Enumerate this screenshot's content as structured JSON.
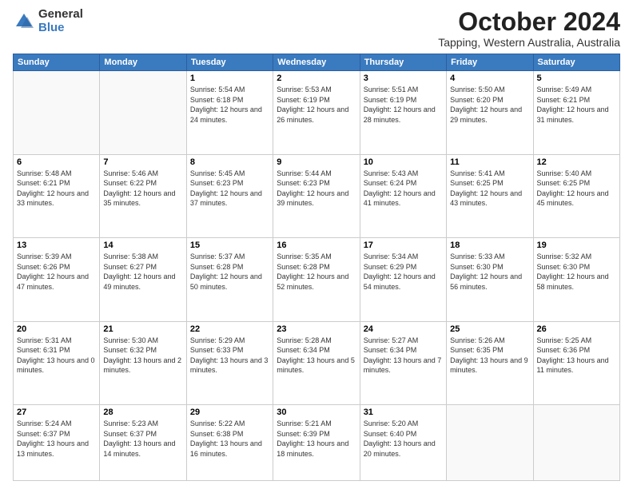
{
  "logo": {
    "general": "General",
    "blue": "Blue"
  },
  "header": {
    "month": "October 2024",
    "location": "Tapping, Western Australia, Australia"
  },
  "weekdays": [
    "Sunday",
    "Monday",
    "Tuesday",
    "Wednesday",
    "Thursday",
    "Friday",
    "Saturday"
  ],
  "weeks": [
    [
      {
        "day": "",
        "info": ""
      },
      {
        "day": "",
        "info": ""
      },
      {
        "day": "1",
        "info": "Sunrise: 5:54 AM\nSunset: 6:18 PM\nDaylight: 12 hours and 24 minutes."
      },
      {
        "day": "2",
        "info": "Sunrise: 5:53 AM\nSunset: 6:19 PM\nDaylight: 12 hours and 26 minutes."
      },
      {
        "day": "3",
        "info": "Sunrise: 5:51 AM\nSunset: 6:19 PM\nDaylight: 12 hours and 28 minutes."
      },
      {
        "day": "4",
        "info": "Sunrise: 5:50 AM\nSunset: 6:20 PM\nDaylight: 12 hours and 29 minutes."
      },
      {
        "day": "5",
        "info": "Sunrise: 5:49 AM\nSunset: 6:21 PM\nDaylight: 12 hours and 31 minutes."
      }
    ],
    [
      {
        "day": "6",
        "info": "Sunrise: 5:48 AM\nSunset: 6:21 PM\nDaylight: 12 hours and 33 minutes."
      },
      {
        "day": "7",
        "info": "Sunrise: 5:46 AM\nSunset: 6:22 PM\nDaylight: 12 hours and 35 minutes."
      },
      {
        "day": "8",
        "info": "Sunrise: 5:45 AM\nSunset: 6:23 PM\nDaylight: 12 hours and 37 minutes."
      },
      {
        "day": "9",
        "info": "Sunrise: 5:44 AM\nSunset: 6:23 PM\nDaylight: 12 hours and 39 minutes."
      },
      {
        "day": "10",
        "info": "Sunrise: 5:43 AM\nSunset: 6:24 PM\nDaylight: 12 hours and 41 minutes."
      },
      {
        "day": "11",
        "info": "Sunrise: 5:41 AM\nSunset: 6:25 PM\nDaylight: 12 hours and 43 minutes."
      },
      {
        "day": "12",
        "info": "Sunrise: 5:40 AM\nSunset: 6:25 PM\nDaylight: 12 hours and 45 minutes."
      }
    ],
    [
      {
        "day": "13",
        "info": "Sunrise: 5:39 AM\nSunset: 6:26 PM\nDaylight: 12 hours and 47 minutes."
      },
      {
        "day": "14",
        "info": "Sunrise: 5:38 AM\nSunset: 6:27 PM\nDaylight: 12 hours and 49 minutes."
      },
      {
        "day": "15",
        "info": "Sunrise: 5:37 AM\nSunset: 6:28 PM\nDaylight: 12 hours and 50 minutes."
      },
      {
        "day": "16",
        "info": "Sunrise: 5:35 AM\nSunset: 6:28 PM\nDaylight: 12 hours and 52 minutes."
      },
      {
        "day": "17",
        "info": "Sunrise: 5:34 AM\nSunset: 6:29 PM\nDaylight: 12 hours and 54 minutes."
      },
      {
        "day": "18",
        "info": "Sunrise: 5:33 AM\nSunset: 6:30 PM\nDaylight: 12 hours and 56 minutes."
      },
      {
        "day": "19",
        "info": "Sunrise: 5:32 AM\nSunset: 6:30 PM\nDaylight: 12 hours and 58 minutes."
      }
    ],
    [
      {
        "day": "20",
        "info": "Sunrise: 5:31 AM\nSunset: 6:31 PM\nDaylight: 13 hours and 0 minutes."
      },
      {
        "day": "21",
        "info": "Sunrise: 5:30 AM\nSunset: 6:32 PM\nDaylight: 13 hours and 2 minutes."
      },
      {
        "day": "22",
        "info": "Sunrise: 5:29 AM\nSunset: 6:33 PM\nDaylight: 13 hours and 3 minutes."
      },
      {
        "day": "23",
        "info": "Sunrise: 5:28 AM\nSunset: 6:34 PM\nDaylight: 13 hours and 5 minutes."
      },
      {
        "day": "24",
        "info": "Sunrise: 5:27 AM\nSunset: 6:34 PM\nDaylight: 13 hours and 7 minutes."
      },
      {
        "day": "25",
        "info": "Sunrise: 5:26 AM\nSunset: 6:35 PM\nDaylight: 13 hours and 9 minutes."
      },
      {
        "day": "26",
        "info": "Sunrise: 5:25 AM\nSunset: 6:36 PM\nDaylight: 13 hours and 11 minutes."
      }
    ],
    [
      {
        "day": "27",
        "info": "Sunrise: 5:24 AM\nSunset: 6:37 PM\nDaylight: 13 hours and 13 minutes."
      },
      {
        "day": "28",
        "info": "Sunrise: 5:23 AM\nSunset: 6:37 PM\nDaylight: 13 hours and 14 minutes."
      },
      {
        "day": "29",
        "info": "Sunrise: 5:22 AM\nSunset: 6:38 PM\nDaylight: 13 hours and 16 minutes."
      },
      {
        "day": "30",
        "info": "Sunrise: 5:21 AM\nSunset: 6:39 PM\nDaylight: 13 hours and 18 minutes."
      },
      {
        "day": "31",
        "info": "Sunrise: 5:20 AM\nSunset: 6:40 PM\nDaylight: 13 hours and 20 minutes."
      },
      {
        "day": "",
        "info": ""
      },
      {
        "day": "",
        "info": ""
      }
    ]
  ]
}
